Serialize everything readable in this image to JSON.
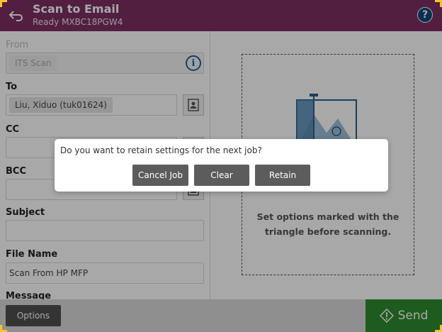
{
  "header": {
    "title": "Scan to Email",
    "subtitle": "Ready MXBC18PGW4",
    "help_label": "?",
    "accent_color": "#7d2f63"
  },
  "form": {
    "from_label": "From",
    "from_value": "ITS Scan",
    "to_label": "To",
    "to_value": "Liu, Xiduo (tuk01624)",
    "cc_label": "CC",
    "cc_value": "",
    "bcc_label": "BCC",
    "bcc_value": "",
    "subject_label": "Subject",
    "subject_value": "",
    "file_name_label": "File Name",
    "file_name_value": "Scan From HP MFP",
    "message_label": "Message"
  },
  "preview": {
    "hint": "Set options marked with the triangle before scanning."
  },
  "footer": {
    "options_label": "Options",
    "send_label": "Send",
    "send_color": "#2e8b2e"
  },
  "dialog": {
    "question": "Do you want to retain settings for the next job?",
    "cancel_label": "Cancel Job",
    "clear_label": "Clear",
    "retain_label": "Retain"
  }
}
